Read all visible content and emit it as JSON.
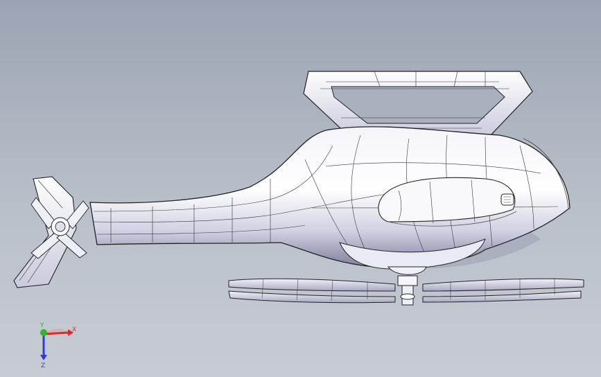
{
  "viewport": {
    "background": "#b2bac5",
    "model": "helicopter-model",
    "orientation_triad": {
      "x_label": "X",
      "y_label": "Y",
      "z_label": "Z",
      "x_color": "#d92b2b",
      "y_color": "#2fb52f",
      "z_color": "#2a3fd1"
    }
  }
}
